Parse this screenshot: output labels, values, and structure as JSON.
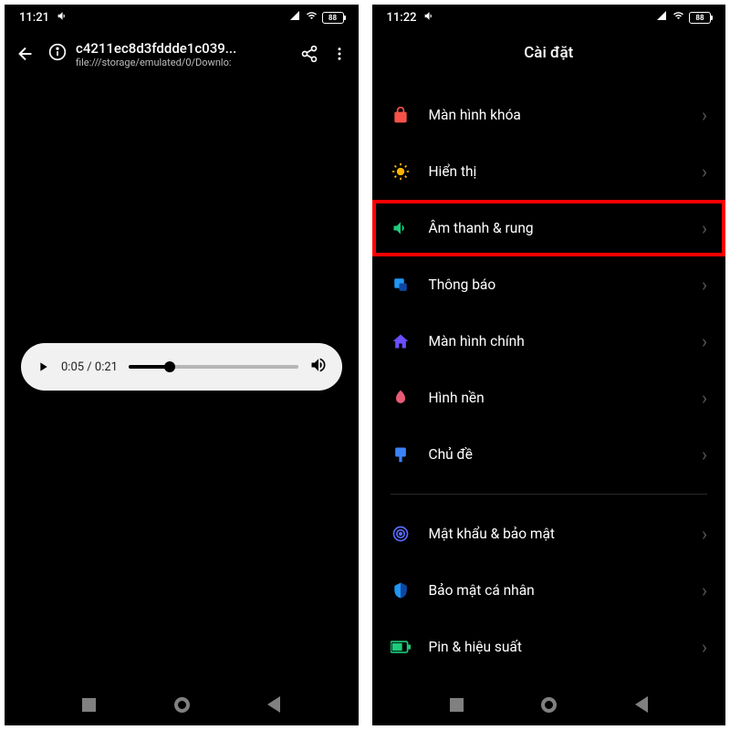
{
  "left": {
    "status": {
      "time": "11:21",
      "battery": "88"
    },
    "header": {
      "title": "c4211ec8d3fddde1c039...",
      "subtitle": "file:///storage/emulated/0/Downlo:"
    },
    "player": {
      "current": "0:05",
      "total": "0:21"
    }
  },
  "right": {
    "status": {
      "time": "11:22",
      "battery": "88"
    },
    "title": "Cài đặt",
    "items": {
      "lock": "Màn hình khóa",
      "display": "Hiển thị",
      "sound": "Âm thanh & rung",
      "notif": "Thông báo",
      "home": "Màn hình chính",
      "wallpaper": "Hình nền",
      "theme": "Chủ đề",
      "security": "Mật khẩu & bảo mật",
      "privacy": "Bảo mật cá nhân",
      "battery": "Pin & hiệu suất"
    }
  }
}
